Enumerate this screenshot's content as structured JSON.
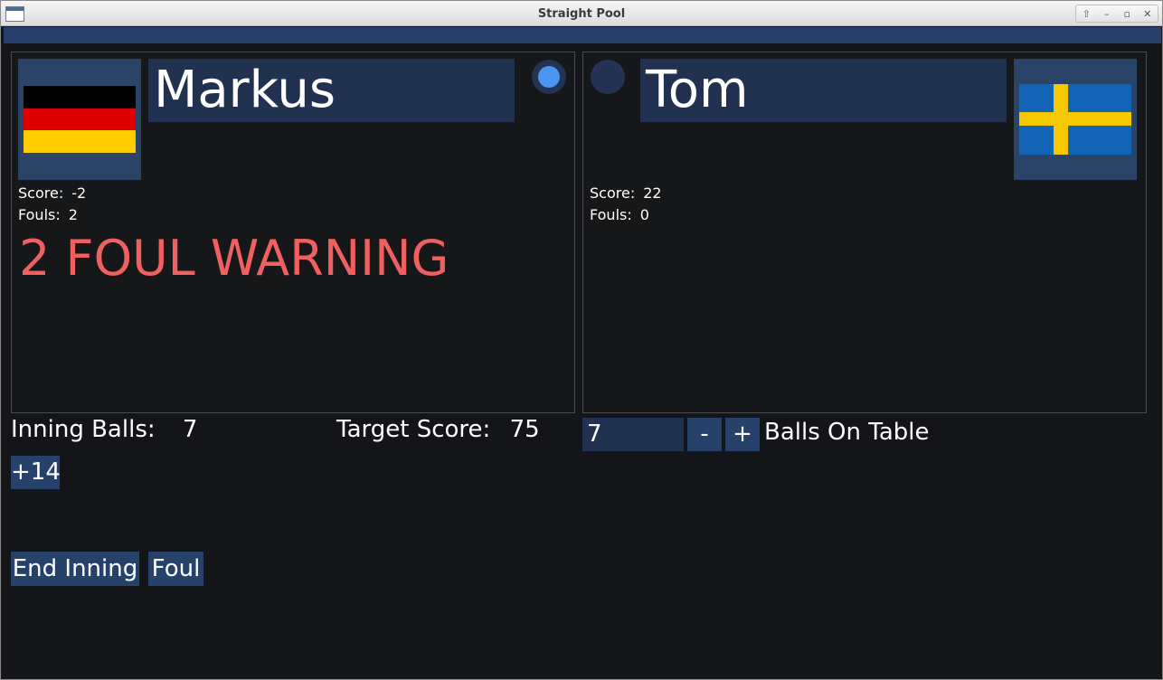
{
  "window": {
    "title": "Straight Pool"
  },
  "wm_buttons": [
    "⇧",
    "–",
    "▫",
    "✕"
  ],
  "player_left": {
    "name": "Markus",
    "flag": "germany-flag",
    "score_label": "Score:",
    "score": "-2",
    "fouls_label": "Fouls:",
    "fouls": "2",
    "warning": "2 FOUL WARNING",
    "active": true
  },
  "player_right": {
    "name": "Tom",
    "flag": "sweden-flag",
    "score_label": "Score:",
    "score": "22",
    "fouls_label": "Fouls:",
    "fouls": "0",
    "active": false
  },
  "inning": {
    "label": "Inning Balls:",
    "value": "7"
  },
  "target": {
    "label": "Target Score:",
    "value": "75"
  },
  "buttons": {
    "plus14": "+14",
    "end_inning": "End Inning",
    "foul": "Foul",
    "minus": "-",
    "plus": "+"
  },
  "balls_on_table": {
    "value": "7",
    "label": "Balls On Table"
  },
  "colors": {
    "background": "#141518",
    "panel_accent": "#213250",
    "button": "#26426a",
    "active_dot": "#4a95f2",
    "warning": "#f06060"
  }
}
